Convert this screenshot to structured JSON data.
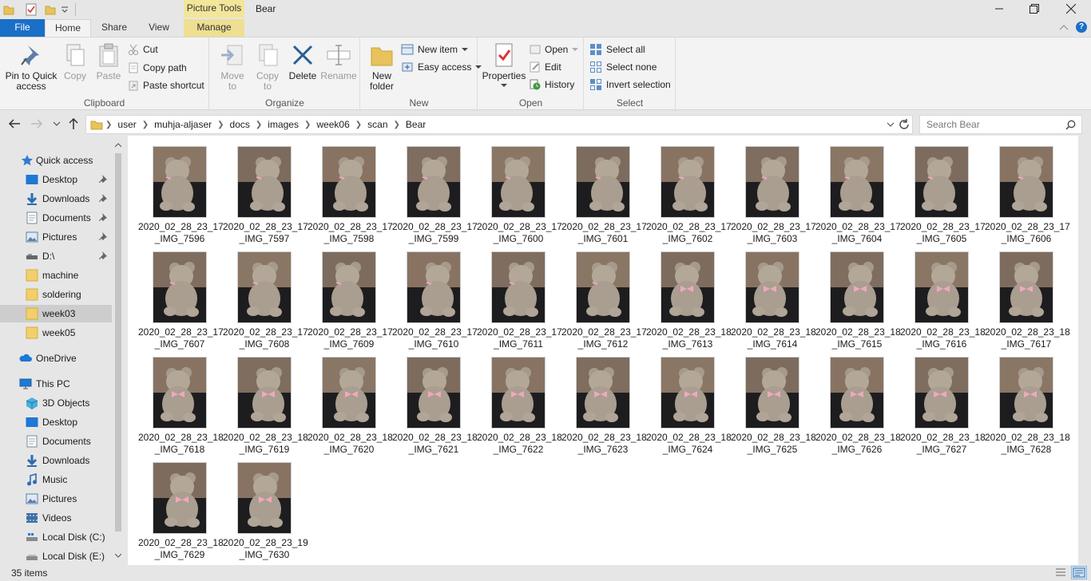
{
  "window": {
    "title": "Bear",
    "context_tab": "Picture Tools"
  },
  "tabs": {
    "file": "File",
    "home": "Home",
    "share": "Share",
    "view": "View",
    "manage": "Manage"
  },
  "ribbon": {
    "clipboard": {
      "label": "Clipboard",
      "pin_line1": "Pin to Quick",
      "pin_line2": "access",
      "copy": "Copy",
      "paste": "Paste",
      "cut": "Cut",
      "copy_path": "Copy path",
      "paste_shortcut": "Paste shortcut"
    },
    "organize": {
      "label": "Organize",
      "move_line1": "Move",
      "move_line2": "to",
      "copyto_line1": "Copy",
      "copyto_line2": "to",
      "delete": "Delete",
      "rename": "Rename"
    },
    "new": {
      "label": "New",
      "folder_line1": "New",
      "folder_line2": "folder",
      "new_item": "New item",
      "easy_access": "Easy access"
    },
    "open": {
      "label": "Open",
      "properties": "Properties",
      "open": "Open",
      "edit": "Edit",
      "history": "History"
    },
    "select": {
      "label": "Select",
      "select_all": "Select all",
      "select_none": "Select none",
      "invert": "Invert selection"
    }
  },
  "address": {
    "crumbs": [
      "user",
      "muhja-aljaser",
      "docs",
      "images",
      "week06",
      "scan",
      "Bear"
    ],
    "search_placeholder": "Search Bear"
  },
  "nav": {
    "quick_access": "Quick access",
    "qa_items": [
      "Desktop",
      "Downloads",
      "Documents",
      "Pictures",
      "D:\\",
      "machine",
      "soldering",
      "week03",
      "week05"
    ],
    "onedrive": "OneDrive",
    "this_pc": "This PC",
    "pc_items": [
      "3D Objects",
      "Desktop",
      "Documents",
      "Downloads",
      "Music",
      "Pictures",
      "Videos",
      "Local Disk (C:)",
      "Local Disk (E:)"
    ]
  },
  "files": [
    {
      "l1": "2020_02_28_23_17",
      "l2": "_IMG_7596"
    },
    {
      "l1": "2020_02_28_23_17",
      "l2": "_IMG_7597"
    },
    {
      "l1": "2020_02_28_23_17",
      "l2": "_IMG_7598"
    },
    {
      "l1": "2020_02_28_23_17",
      "l2": "_IMG_7599"
    },
    {
      "l1": "2020_02_28_23_17",
      "l2": "_IMG_7600"
    },
    {
      "l1": "2020_02_28_23_17",
      "l2": "_IMG_7601"
    },
    {
      "l1": "2020_02_28_23_17",
      "l2": "_IMG_7602"
    },
    {
      "l1": "2020_02_28_23_17",
      "l2": "_IMG_7603"
    },
    {
      "l1": "2020_02_28_23_17",
      "l2": "_IMG_7604"
    },
    {
      "l1": "2020_02_28_23_17",
      "l2": "_IMG_7605"
    },
    {
      "l1": "2020_02_28_23_17",
      "l2": "_IMG_7606"
    },
    {
      "l1": "2020_02_28_23_17",
      "l2": "_IMG_7607"
    },
    {
      "l1": "2020_02_28_23_17",
      "l2": "_IMG_7608"
    },
    {
      "l1": "2020_02_28_23_17",
      "l2": "_IMG_7609"
    },
    {
      "l1": "2020_02_28_23_17",
      "l2": "_IMG_7610"
    },
    {
      "l1": "2020_02_28_23_17",
      "l2": "_IMG_7611"
    },
    {
      "l1": "2020_02_28_23_17",
      "l2": "_IMG_7612"
    },
    {
      "l1": "2020_02_28_23_18",
      "l2": "_IMG_7613"
    },
    {
      "l1": "2020_02_28_23_18",
      "l2": "_IMG_7614"
    },
    {
      "l1": "2020_02_28_23_18",
      "l2": "_IMG_7615"
    },
    {
      "l1": "2020_02_28_23_18",
      "l2": "_IMG_7616"
    },
    {
      "l1": "2020_02_28_23_18",
      "l2": "_IMG_7617"
    },
    {
      "l1": "2020_02_28_23_18",
      "l2": "_IMG_7618"
    },
    {
      "l1": "2020_02_28_23_18",
      "l2": "_IMG_7619"
    },
    {
      "l1": "2020_02_28_23_18",
      "l2": "_IMG_7620"
    },
    {
      "l1": "2020_02_28_23_18",
      "l2": "_IMG_7621"
    },
    {
      "l1": "2020_02_28_23_18",
      "l2": "_IMG_7622"
    },
    {
      "l1": "2020_02_28_23_18",
      "l2": "_IMG_7623"
    },
    {
      "l1": "2020_02_28_23_18",
      "l2": "_IMG_7624"
    },
    {
      "l1": "2020_02_28_23_18",
      "l2": "_IMG_7625"
    },
    {
      "l1": "2020_02_28_23_18",
      "l2": "_IMG_7626"
    },
    {
      "l1": "2020_02_28_23_18",
      "l2": "_IMG_7627"
    },
    {
      "l1": "2020_02_28_23_18",
      "l2": "_IMG_7628"
    },
    {
      "l1": "2020_02_28_23_18",
      "l2": "_IMG_7629"
    },
    {
      "l1": "2020_02_28_23_19",
      "l2": "_IMG_7630"
    }
  ],
  "status": {
    "item_count": "35 items"
  },
  "colors": {
    "accent": "#1a6fc7",
    "context_tab": "#f3e59a",
    "folder": "#e8c25a",
    "bow": "#f2a6c0"
  }
}
